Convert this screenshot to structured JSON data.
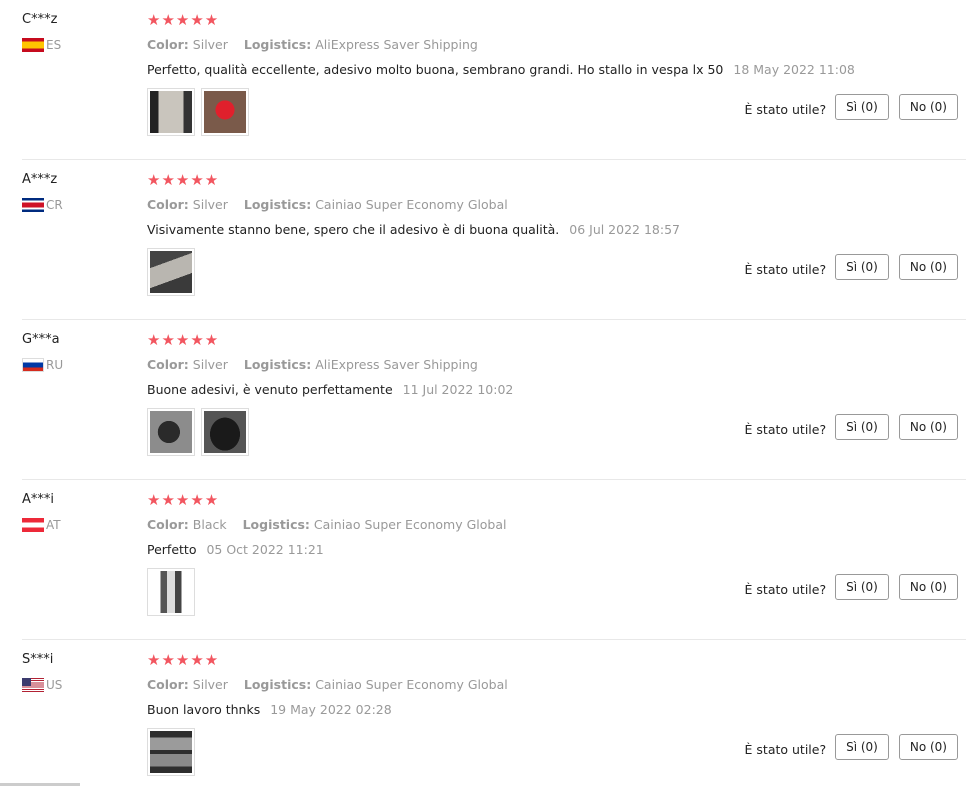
{
  "reviews": [
    {
      "name": "C***z",
      "country": "ES",
      "flag": "es-flag",
      "stars": "★★★★★",
      "color_label": "Color:",
      "color": "Silver",
      "logistics_label": "Logistics:",
      "logistics": "AliExpress Saver Shipping",
      "text": "Perfetto, qualità eccellente, adesivo molto buona, sembrano grandi. Ho stallo in vespa lx 50",
      "date": "18 May 2022 11:08",
      "thumbs": 2,
      "helpful": "È stato utile?",
      "yes": "Sì (0)",
      "no": "No (0)"
    },
    {
      "name": "A***z",
      "country": "CR",
      "flag": "cr-flag",
      "stars": "★★★★★",
      "color_label": "Color:",
      "color": "Silver",
      "logistics_label": "Logistics:",
      "logistics": "Cainiao Super Economy Global",
      "text": "Visivamente stanno bene, spero che il adesivo è di buona qualità.",
      "date": "06 Jul 2022 18:57",
      "thumbs": 1,
      "helpful": "È stato utile?",
      "yes": "Sì (0)",
      "no": "No (0)"
    },
    {
      "name": "G***a",
      "country": "RU",
      "flag": "ru-flag",
      "stars": "★★★★★",
      "color_label": "Color:",
      "color": "Silver",
      "logistics_label": "Logistics:",
      "logistics": "AliExpress Saver Shipping",
      "text": "Buone adesivi, è venuto perfettamente",
      "date": "11 Jul 2022 10:02",
      "thumbs": 2,
      "helpful": "È stato utile?",
      "yes": "Sì (0)",
      "no": "No (0)"
    },
    {
      "name": "A***i",
      "country": "AT",
      "flag": "at-flag",
      "stars": "★★★★★",
      "color_label": "Color:",
      "color": "Black",
      "logistics_label": "Logistics:",
      "logistics": "Cainiao Super Economy Global",
      "text": "Perfetto",
      "date": "05 Oct 2022 11:21",
      "thumbs": 1,
      "helpful": "È stato utile?",
      "yes": "Sì (0)",
      "no": "No (0)"
    },
    {
      "name": "S***i",
      "country": "US",
      "flag": "us-flag",
      "stars": "★★★★★",
      "color_label": "Color:",
      "color": "Silver",
      "logistics_label": "Logistics:",
      "logistics": "Cainiao Super Economy Global",
      "text": "Buon lavoro thnks",
      "date": "19 May 2022 02:28",
      "thumbs": 1,
      "helpful": "È stato utile?",
      "yes": "Sì (0)",
      "no": "No (0)"
    }
  ],
  "colors": {
    "star": "#f25660",
    "muted": "#999999",
    "divider": "#e8e8e8"
  }
}
